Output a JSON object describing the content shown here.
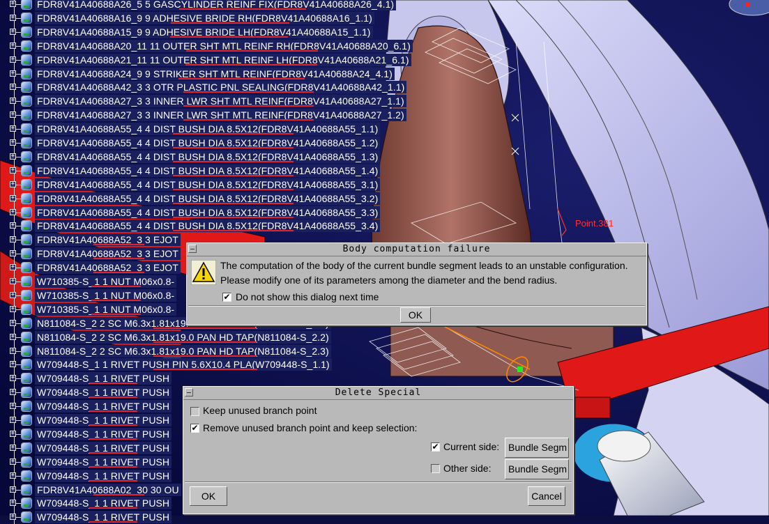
{
  "tree_items": [
    {
      "label": "FDR8V41A40688A26_5 5 GASCYLINDER REINF FIX(FDR8V41A40688A26_4.1)"
    },
    {
      "label": "FDR8V41A40688A16_9 9 ADHESIVE BRIDE RH(FDR8V41A40688A16_1.1)"
    },
    {
      "label": "FDR8V41A40688A15_9 9 ADHESIVE BRIDE LH(FDR8V41A40688A15_1.1)"
    },
    {
      "label": "FDR8V41A40688A20_11 11 OUTER SHT MTL REINF RH(FDR8V41A40688A20_6.1)"
    },
    {
      "label": "FDR8V41A40688A21_11 11 OUTER SHT MTL REINF LH(FDR8V41A40688A21_6.1)"
    },
    {
      "label": "FDR8V41A40688A24_9 9 STRIKER SHT MTL REINF(FDR8V41A40688A24_4.1)"
    },
    {
      "label": "FDR8V41A40688A42_3 3 OTR PLASTIC PNL SEALING(FDR8V41A40688A42_1.1)"
    },
    {
      "label": "FDR8V41A40688A27_3 3 INNER LWR SHT MTL REINF(FDR8V41A40688A27_1.1)"
    },
    {
      "label": "FDR8V41A40688A27_3 3 INNER LWR SHT MTL REINF(FDR8V41A40688A27_1.2)"
    },
    {
      "label": "FDR8V41A40688A55_4 4 DIST BUSH DIA 8.5X12(FDR8V41A40688A55_1.1)"
    },
    {
      "label": "FDR8V41A40688A55_4 4 DIST BUSH DIA 8.5X12(FDR8V41A40688A55_1.2)"
    },
    {
      "label": "FDR8V41A40688A55_4 4 DIST BUSH DIA 8.5X12(FDR8V41A40688A55_1.3)"
    },
    {
      "label": "FDR8V41A40688A55_4 4 DIST BUSH DIA 8.5X12(FDR8V41A40688A55_1.4)"
    },
    {
      "label": "FDR8V41A40688A55_4 4 DIST BUSH DIA 8.5X12(FDR8V41A40688A55_3.1)"
    },
    {
      "label": "FDR8V41A40688A55_4 4 DIST BUSH DIA 8.5X12(FDR8V41A40688A55_3.2)"
    },
    {
      "label": "FDR8V41A40688A55_4 4 DIST BUSH DIA 8.5X12(FDR8V41A40688A55_3.3)"
    },
    {
      "label": "FDR8V41A40688A55_4 4 DIST BUSH DIA 8.5X12(FDR8V41A40688A55_3.4)"
    },
    {
      "label": "FDR8V41A40688A52_3 3 EJOT"
    },
    {
      "label": "FDR8V41A40688A52_3 3 EJOT"
    },
    {
      "label": "FDR8V41A40688A52_3 3 EJOT"
    },
    {
      "label": "W710385-S_1 1 NUT M06x0.8-"
    },
    {
      "label": "W710385-S_1 1 NUT M06x0.8-"
    },
    {
      "label": "W710385-S_1 1 NUT M06x0.8-"
    },
    {
      "label": "N811084-S_2 2 SC M6.3x1.81x19.0 PAN HD TAP(N811084-S_2.1)"
    },
    {
      "label": "N811084-S_2 2 SC M6.3x1.81x19.0 PAN HD TAP(N811084-S_2.2)"
    },
    {
      "label": "N811084-S_2 2 SC M6.3x1.81x19.0 PAN HD TAP(N811084-S_2.3)"
    },
    {
      "label": "W709448-S_1 1 RIVET PUSH PIN 5.6X10.4 PLA(W709448-S_1.1)"
    },
    {
      "label": "W709448-S_1 1 RIVET PUSH"
    },
    {
      "label": "W709448-S_1 1 RIVET PUSH"
    },
    {
      "label": "W709448-S_1 1 RIVET PUSH"
    },
    {
      "label": "W709448-S_1 1 RIVET PUSH"
    },
    {
      "label": "W709448-S_1 1 RIVET PUSH"
    },
    {
      "label": "W709448-S_1 1 RIVET PUSH"
    },
    {
      "label": "W709448-S_1 1 RIVET PUSH"
    },
    {
      "label": "W709448-S_1 1 RIVET PUSH"
    },
    {
      "label": "FDR8V41A40688A02_30 30 OU"
    },
    {
      "label": "W709448-S_1 1 RIVET PUSH"
    },
    {
      "label": "W709448-S_1 1 RIVET PUSH"
    }
  ],
  "viewport": {
    "point_label": "Point.381"
  },
  "body_failure_dialog": {
    "title": "Body computation failure",
    "message_line1": "The computation of the body of the current bundle segment leads to an unstable configuration.",
    "message_line2": "Please modify one of its parameters among the diameter and the bend radius.",
    "dont_show_label": "Do not show this dialog next time",
    "dont_show_checked": true,
    "ok_label": "OK",
    "icon": "warning-icon"
  },
  "delete_special_dialog": {
    "title": "Delete Special",
    "keep_label": "Keep unused branch point",
    "keep_checked": false,
    "remove_label": "Remove unused branch point and keep selection:",
    "remove_checked": true,
    "current_side_label": "Current side:",
    "current_side_checked": true,
    "current_side_value": "Bundle Segm",
    "other_side_label": "Other side:",
    "other_side_checked": false,
    "other_side_value": "Bundle Segm",
    "ok_label": "OK",
    "cancel_label": "Cancel"
  }
}
